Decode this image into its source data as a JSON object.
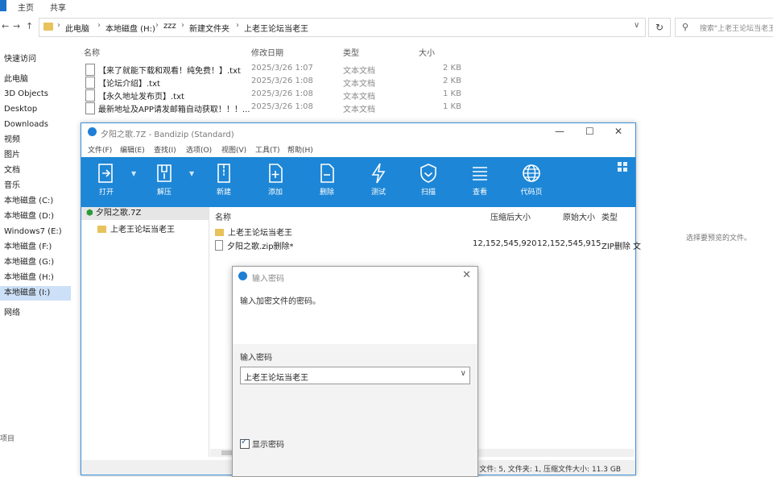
{
  "explorer": {
    "tabs": [
      "主页",
      "共享"
    ],
    "nav": {
      "back": "←",
      "forward": "→",
      "up": "↑"
    },
    "breadcrumb": [
      "此电脑",
      "本地磁盘 (H:)",
      "zzz",
      "新建文件夹",
      "上老王论坛当老王"
    ],
    "search_placeholder": "搜索\"上老王论坛当老王\"",
    "sidebar": [
      "快速访问",
      "此电脑",
      "3D Objects",
      "Desktop",
      "Downloads",
      "视频",
      "图片",
      "文档",
      "音乐",
      "本地磁盘 (C:)",
      "本地磁盘 (D:)",
      "Windows7 (E:)",
      "本地磁盘 (F:)",
      "本地磁盘 (G:)",
      "本地磁盘 (H:)",
      "本地磁盘 (I:)",
      "网络"
    ],
    "columns": {
      "name": "名称",
      "date": "修改日期",
      "type": "类型",
      "size": "大小"
    },
    "files": [
      {
        "name": "【来了就能下载和观看！纯免费！】.txt",
        "date": "2025/3/26 1:07",
        "type": "文本文档",
        "size": "2 KB"
      },
      {
        "name": "【论坛介绍】.txt",
        "date": "2025/3/26 1:08",
        "type": "文本文档",
        "size": "2 KB"
      },
      {
        "name": "【永久地址发布页】.txt",
        "date": "2025/3/26 1:08",
        "type": "文本文档",
        "size": "1 KB"
      },
      {
        "name": "最新地址及APP请发邮箱自动获取！！！...",
        "date": "2025/3/26 1:08",
        "type": "文本文档",
        "size": "1 KB"
      }
    ],
    "preview_message": "选择要预览的文件。",
    "status_left": "项目"
  },
  "bandizip": {
    "title": "夕阳之歌.7Z - Bandizip (Standard)",
    "window_buttons": {
      "minimize": "—",
      "maximize": "☐",
      "close": "✕"
    },
    "menu": [
      "文件(F)",
      "编辑(E)",
      "查找(I)",
      "选项(O)",
      "视图(V)",
      "工具(T)",
      "帮助(H)"
    ],
    "toolbar": [
      "打开",
      "解压",
      "新建",
      "添加",
      "删除",
      "测试",
      "扫描",
      "查看",
      "代码页"
    ],
    "tree_root": "夕阳之歌.7Z",
    "tree_child": "上老王论坛当老王",
    "columns": {
      "name": "名称",
      "compressed": "压缩后大小",
      "original": "原始大小",
      "type": "类型"
    },
    "rows": [
      {
        "name": "上老王论坛当老王",
        "compressed": "",
        "original": "",
        "type": ""
      },
      {
        "name": "夕阳之歌.zip删除*",
        "compressed": "12,152,545,920",
        "original": "12,152,545,915",
        "type": "ZIP删除 文"
      }
    ],
    "status": "文件: 5, 文件夹: 1, 压缩文件大小: 11.3 GB"
  },
  "dialog": {
    "title": "输入密码",
    "close": "✕",
    "message": "输入加密文件的密码。",
    "input_label": "输入密码",
    "password_value": "上老王论坛当老王",
    "dropdown": "∨",
    "checkbox_label": "显示密码",
    "checkbox_checked": true
  },
  "colors": {
    "toolbar_blue": "#1d86d6",
    "selection": "#cce0f7",
    "folder": "#e8c25a"
  }
}
